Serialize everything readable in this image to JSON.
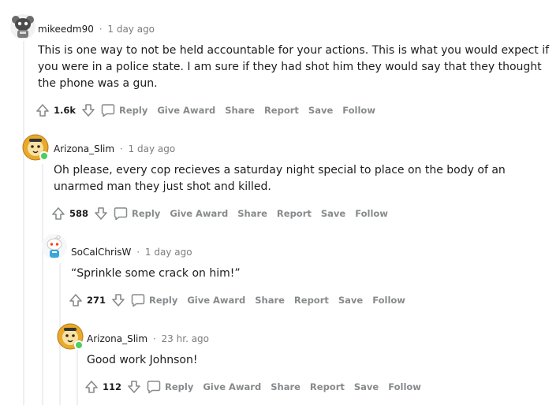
{
  "comments": [
    {
      "username": "mikeedm90",
      "time": "1 day ago",
      "body": "This is one way to not be held accountable for your actions. This is what you would expect if you were in a police state. I am sure if they had shot him they would say that they thought the phone was a gun.",
      "score": "1.6k",
      "avatar_icon": "robot-avatar-icon"
    },
    {
      "username": "Arizona_Slim",
      "time": "1 day ago",
      "body": "Oh please, every cop recieves a saturday night special to place on the body of an unarmed man they just shot and killed.",
      "score": "588",
      "avatar_icon": "lion-avatar-icon",
      "online": true
    },
    {
      "username": "SoCalChrisW",
      "time": "1 day ago",
      "body": "“Sprinkle some crack on him!”",
      "score": "271",
      "avatar_icon": "snoo-avatar-icon"
    },
    {
      "username": "Arizona_Slim",
      "time": "23 hr. ago",
      "body": "Good work Johnson!",
      "score": "112",
      "avatar_icon": "lion-avatar-icon",
      "online": true
    }
  ],
  "actions": {
    "reply": "Reply",
    "give_award": "Give Award",
    "share": "Share",
    "report": "Report",
    "save": "Save",
    "follow": "Follow"
  },
  "separator": "·",
  "colors": {
    "meta_gray": "#7c7c7c",
    "action_gray": "#878a8c",
    "thread_line": "#edeff1",
    "online_green": "#46d160"
  }
}
